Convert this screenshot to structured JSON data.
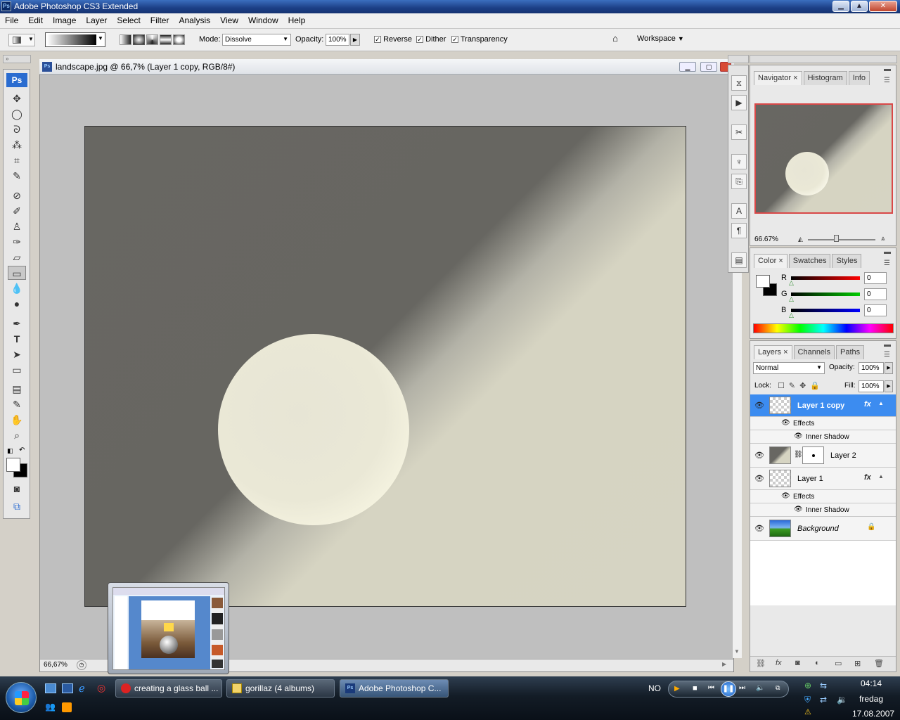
{
  "app": {
    "title": "Adobe Photoshop CS3 Extended",
    "icon": "Ps"
  },
  "menu": [
    "File",
    "Edit",
    "Image",
    "Layer",
    "Select",
    "Filter",
    "Analysis",
    "View",
    "Window",
    "Help"
  ],
  "options": {
    "mode_label": "Mode:",
    "mode_value": "Dissolve",
    "opacity_label": "Opacity:",
    "opacity_value": "100%",
    "reverse_label": "Reverse",
    "dither_label": "Dither",
    "transparency_label": "Transparency",
    "workspace_label": "Workspace"
  },
  "document": {
    "title": "landscape.jpg @ 66,7% (Layer 1 copy, RGB/8#)",
    "zoom": "66,67%"
  },
  "navigator": {
    "tabs": [
      "Navigator",
      "Histogram",
      "Info"
    ],
    "zoom": "66.67%"
  },
  "color_panel": {
    "tabs": [
      "Color",
      "Swatches",
      "Styles"
    ],
    "channels": [
      {
        "label": "R",
        "value": "0",
        "color": "#d40000"
      },
      {
        "label": "G",
        "value": "0",
        "color": "#00b400"
      },
      {
        "label": "B",
        "value": "0",
        "color": "#0000cc"
      }
    ]
  },
  "layers_panel": {
    "tabs": [
      "Layers",
      "Channels",
      "Paths"
    ],
    "blend_mode": "Normal",
    "opacity_label": "Opacity:",
    "opacity_value": "100%",
    "lock_label": "Lock:",
    "fill_label": "Fill:",
    "fill_value": "100%",
    "layers": [
      {
        "name": "Layer 1 copy",
        "effects": "Effects",
        "effect": "Inner Shadow",
        "fx": "fx"
      },
      {
        "name": "Layer 2"
      },
      {
        "name": "Layer 1",
        "effects": "Effects",
        "effect": "Inner Shadow",
        "fx": "fx"
      },
      {
        "name": "Background"
      }
    ]
  },
  "taskbar": {
    "tasks": [
      "creating a glass ball ...",
      "gorillaz (4 albums)",
      "Adobe Photoshop C..."
    ],
    "lang": "NO",
    "time": "04:14",
    "day": "fredag",
    "date": "17.08.2007"
  },
  "colors": {
    "accent": "#3a7fe0",
    "selected_layer": "#3c8cf0"
  }
}
